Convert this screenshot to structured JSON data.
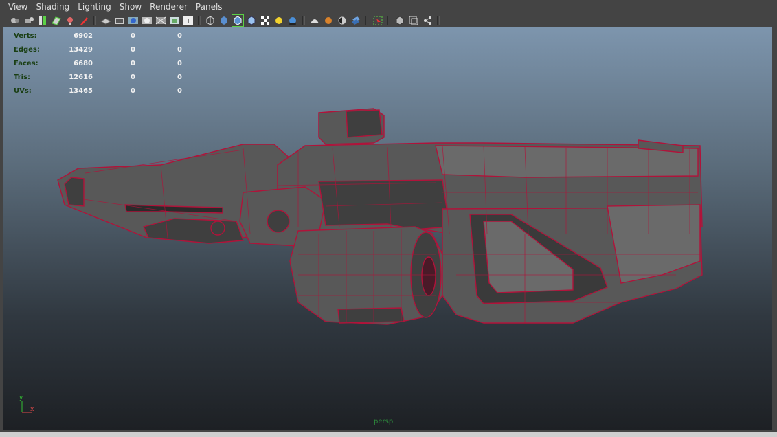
{
  "menu": [
    "View",
    "Shading",
    "Lighting",
    "Show",
    "Renderer",
    "Panels"
  ],
  "toolbar": {
    "groups": [
      [
        "select-camera-icon",
        "camera-attributes-icon",
        "bookmark-icon",
        "image-plane-icon",
        "2d-pan-zoom-icon",
        "grease-pencil-icon"
      ],
      [
        "grid-icon",
        "film-gate-icon",
        "resolution-gate-icon",
        "gate-mask-icon",
        "field-chart-icon",
        "safe-action-icon",
        "safe-title-icon"
      ],
      [
        "wireframe-icon",
        "smooth-shade-icon",
        "wireframe-on-shaded-icon",
        "default-material-icon",
        "textured-icon",
        "use-all-lights-icon",
        "shadows-icon"
      ],
      [
        "screen-space-ambient-occlusion-icon",
        "motion-blur-icon",
        "multisample-antialiasing-icon",
        "depth-of-field-icon"
      ],
      [
        "isolate-select-icon"
      ],
      [
        "xray-icon",
        "xray-active-components-icon",
        "xray-joints-icon"
      ]
    ],
    "active": "wireframe-on-shaded-icon",
    "text_glyph": "T"
  },
  "hud": {
    "rows": [
      {
        "label": "Verts:",
        "values": [
          "6902",
          "0",
          "0"
        ]
      },
      {
        "label": "Edges:",
        "values": [
          "13429",
          "0",
          "0"
        ]
      },
      {
        "label": "Faces:",
        "values": [
          "6680",
          "0",
          "0"
        ]
      },
      {
        "label": "Tris:",
        "values": [
          "12616",
          "0",
          "0"
        ]
      },
      {
        "label": "UVs:",
        "values": [
          "13465",
          "0",
          "0"
        ]
      }
    ]
  },
  "axis": {
    "y": "y",
    "x": "x"
  },
  "camera": "persp",
  "colors": {
    "wire": "#b0133a",
    "mesh": "#585858",
    "mesh_dark": "#3f3f3f",
    "mesh_light": "#6a6a6a",
    "hud_label": "#1a3f14",
    "camera_label": "#2e8a3c"
  }
}
